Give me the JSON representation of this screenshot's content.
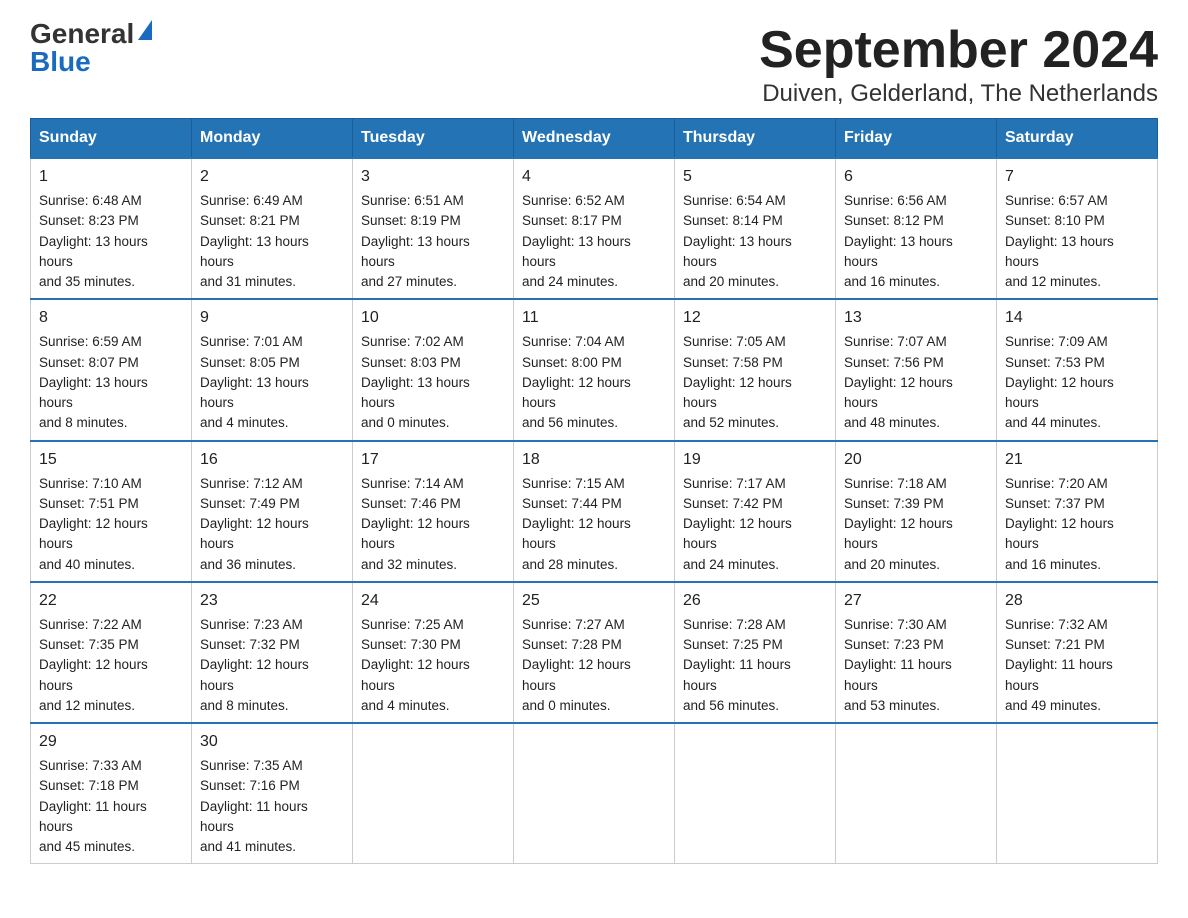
{
  "header": {
    "logo": {
      "general": "General",
      "blue": "Blue",
      "triangle": "▶"
    },
    "title": "September 2024",
    "subtitle": "Duiven, Gelderland, The Netherlands"
  },
  "weekdays": [
    "Sunday",
    "Monday",
    "Tuesday",
    "Wednesday",
    "Thursday",
    "Friday",
    "Saturday"
  ],
  "weeks": [
    [
      {
        "day": 1,
        "sunrise": "6:48 AM",
        "sunset": "8:23 PM",
        "daylight": "13 hours and 35 minutes."
      },
      {
        "day": 2,
        "sunrise": "6:49 AM",
        "sunset": "8:21 PM",
        "daylight": "13 hours and 31 minutes."
      },
      {
        "day": 3,
        "sunrise": "6:51 AM",
        "sunset": "8:19 PM",
        "daylight": "13 hours and 27 minutes."
      },
      {
        "day": 4,
        "sunrise": "6:52 AM",
        "sunset": "8:17 PM",
        "daylight": "13 hours and 24 minutes."
      },
      {
        "day": 5,
        "sunrise": "6:54 AM",
        "sunset": "8:14 PM",
        "daylight": "13 hours and 20 minutes."
      },
      {
        "day": 6,
        "sunrise": "6:56 AM",
        "sunset": "8:12 PM",
        "daylight": "13 hours and 16 minutes."
      },
      {
        "day": 7,
        "sunrise": "6:57 AM",
        "sunset": "8:10 PM",
        "daylight": "13 hours and 12 minutes."
      }
    ],
    [
      {
        "day": 8,
        "sunrise": "6:59 AM",
        "sunset": "8:07 PM",
        "daylight": "13 hours and 8 minutes."
      },
      {
        "day": 9,
        "sunrise": "7:01 AM",
        "sunset": "8:05 PM",
        "daylight": "13 hours and 4 minutes."
      },
      {
        "day": 10,
        "sunrise": "7:02 AM",
        "sunset": "8:03 PM",
        "daylight": "13 hours and 0 minutes."
      },
      {
        "day": 11,
        "sunrise": "7:04 AM",
        "sunset": "8:00 PM",
        "daylight": "12 hours and 56 minutes."
      },
      {
        "day": 12,
        "sunrise": "7:05 AM",
        "sunset": "7:58 PM",
        "daylight": "12 hours and 52 minutes."
      },
      {
        "day": 13,
        "sunrise": "7:07 AM",
        "sunset": "7:56 PM",
        "daylight": "12 hours and 48 minutes."
      },
      {
        "day": 14,
        "sunrise": "7:09 AM",
        "sunset": "7:53 PM",
        "daylight": "12 hours and 44 minutes."
      }
    ],
    [
      {
        "day": 15,
        "sunrise": "7:10 AM",
        "sunset": "7:51 PM",
        "daylight": "12 hours and 40 minutes."
      },
      {
        "day": 16,
        "sunrise": "7:12 AM",
        "sunset": "7:49 PM",
        "daylight": "12 hours and 36 minutes."
      },
      {
        "day": 17,
        "sunrise": "7:14 AM",
        "sunset": "7:46 PM",
        "daylight": "12 hours and 32 minutes."
      },
      {
        "day": 18,
        "sunrise": "7:15 AM",
        "sunset": "7:44 PM",
        "daylight": "12 hours and 28 minutes."
      },
      {
        "day": 19,
        "sunrise": "7:17 AM",
        "sunset": "7:42 PM",
        "daylight": "12 hours and 24 minutes."
      },
      {
        "day": 20,
        "sunrise": "7:18 AM",
        "sunset": "7:39 PM",
        "daylight": "12 hours and 20 minutes."
      },
      {
        "day": 21,
        "sunrise": "7:20 AM",
        "sunset": "7:37 PM",
        "daylight": "12 hours and 16 minutes."
      }
    ],
    [
      {
        "day": 22,
        "sunrise": "7:22 AM",
        "sunset": "7:35 PM",
        "daylight": "12 hours and 12 minutes."
      },
      {
        "day": 23,
        "sunrise": "7:23 AM",
        "sunset": "7:32 PM",
        "daylight": "12 hours and 8 minutes."
      },
      {
        "day": 24,
        "sunrise": "7:25 AM",
        "sunset": "7:30 PM",
        "daylight": "12 hours and 4 minutes."
      },
      {
        "day": 25,
        "sunrise": "7:27 AM",
        "sunset": "7:28 PM",
        "daylight": "12 hours and 0 minutes."
      },
      {
        "day": 26,
        "sunrise": "7:28 AM",
        "sunset": "7:25 PM",
        "daylight": "11 hours and 56 minutes."
      },
      {
        "day": 27,
        "sunrise": "7:30 AM",
        "sunset": "7:23 PM",
        "daylight": "11 hours and 53 minutes."
      },
      {
        "day": 28,
        "sunrise": "7:32 AM",
        "sunset": "7:21 PM",
        "daylight": "11 hours and 49 minutes."
      }
    ],
    [
      {
        "day": 29,
        "sunrise": "7:33 AM",
        "sunset": "7:18 PM",
        "daylight": "11 hours and 45 minutes."
      },
      {
        "day": 30,
        "sunrise": "7:35 AM",
        "sunset": "7:16 PM",
        "daylight": "11 hours and 41 minutes."
      },
      null,
      null,
      null,
      null,
      null
    ]
  ]
}
